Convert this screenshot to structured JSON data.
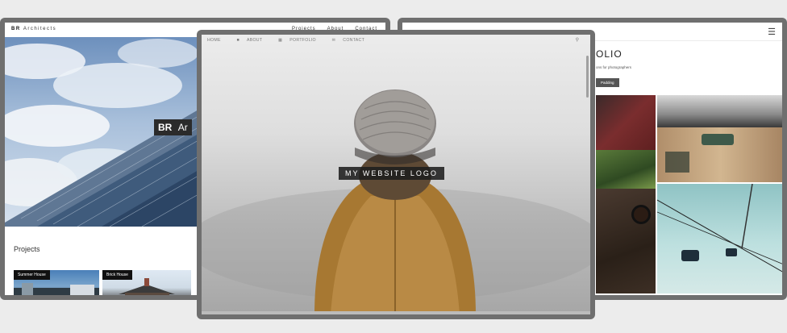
{
  "left_window": {
    "brand_bold": "BR",
    "brand_rest": "Architects",
    "nav_links": [
      "Projects",
      "About",
      "Contact"
    ],
    "hero_badge_bold": "BR",
    "hero_badge_rest": "Ar",
    "projects_heading": "Projects",
    "projects": [
      {
        "label": "Summer House"
      },
      {
        "label": "Brick House"
      }
    ]
  },
  "center_window": {
    "nav_items": [
      {
        "label": "HOME",
        "icon": ""
      },
      {
        "label": "ABOUT",
        "icon": "person-icon"
      },
      {
        "label": "PORTFOLIO",
        "icon": "gallery-icon"
      },
      {
        "label": "CONTACT",
        "icon": "mail-icon"
      }
    ],
    "search_icon": "search-icon",
    "logo_text": "MY WEBSITE LOGO"
  },
  "right_window": {
    "title_partial": "OLIO",
    "subtitle_partial": "ons for photographers",
    "button_partial": "Padding",
    "menu_icon": "hamburger-icon"
  },
  "colors": {
    "frame": "#6f6f6f",
    "background": "#ececec",
    "logo_badge": "#1e1e1e"
  }
}
